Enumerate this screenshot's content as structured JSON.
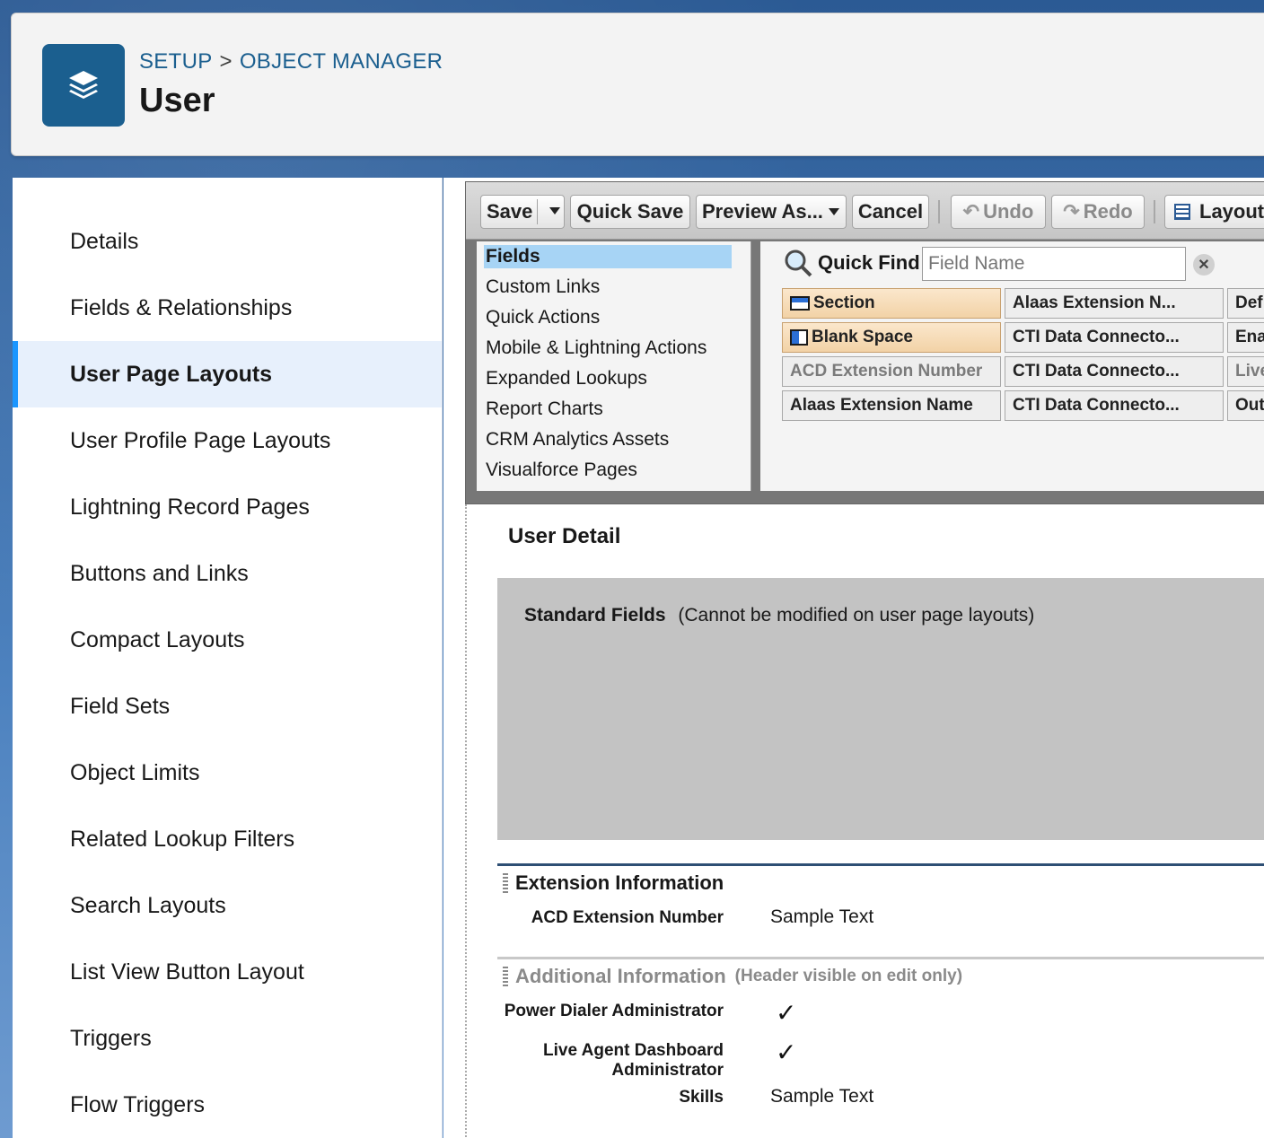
{
  "header": {
    "breadcrumb_setup": "SETUP",
    "breadcrumb_sep": ">",
    "breadcrumb_object_manager": "OBJECT MANAGER",
    "title": "User",
    "icon": "layers-icon",
    "icon_color": "#1b5f8f"
  },
  "sidebar": {
    "items": [
      {
        "label": "Details"
      },
      {
        "label": "Fields & Relationships"
      },
      {
        "label": "User Page Layouts",
        "active": true
      },
      {
        "label": "User Profile Page Layouts"
      },
      {
        "label": "Lightning Record Pages"
      },
      {
        "label": "Buttons and Links"
      },
      {
        "label": "Compact Layouts"
      },
      {
        "label": "Field Sets"
      },
      {
        "label": "Object Limits"
      },
      {
        "label": "Related Lookup Filters"
      },
      {
        "label": "Search Layouts"
      },
      {
        "label": "List View Button Layout"
      },
      {
        "label": "Triggers"
      },
      {
        "label": "Flow Triggers"
      }
    ],
    "active_accent": "#1b96ff"
  },
  "toolbar": {
    "save": "Save",
    "quick_save": "Quick Save",
    "preview_as": "Preview As...",
    "cancel": "Cancel",
    "undo": "Undo",
    "redo": "Redo",
    "layout": "Layout"
  },
  "palette": {
    "categories": [
      {
        "label": "Fields",
        "selected": true
      },
      {
        "label": "Custom Links"
      },
      {
        "label": "Quick Actions"
      },
      {
        "label": "Mobile & Lightning Actions"
      },
      {
        "label": "Expanded Lookups"
      },
      {
        "label": "Report Charts"
      },
      {
        "label": "CRM Analytics Assets"
      },
      {
        "label": "Visualforce Pages"
      }
    ],
    "quick_find_label": "Quick Find",
    "quick_find_placeholder": "Field Name",
    "fields": {
      "col1": [
        "Section",
        "Blank Space",
        "ACD Extension Number",
        "Alaas Extension Name"
      ],
      "col2": [
        "Alaas Extension N...",
        "CTI Data Connecto...",
        "CTI Data Connecto...",
        "CTI Data Connecto..."
      ],
      "col3": [
        "Def",
        "Ena",
        "Live",
        "Out"
      ]
    }
  },
  "canvas": {
    "detail_title": "User Detail",
    "standard_fields_label": "Standard Fields",
    "standard_fields_note": "(Cannot be modified on user page layouts)",
    "sections": [
      {
        "name": "Extension Information",
        "fields": [
          {
            "label": "ACD Extension Number",
            "value": "Sample Text"
          }
        ]
      },
      {
        "name": "Additional Information",
        "note": "(Header visible on edit only)",
        "fields": [
          {
            "label": "Power Dialer Administrator",
            "checked": true
          },
          {
            "label": "Live Agent Dashboard Administrator",
            "label_line1": "Live Agent Dashboard",
            "label_line2": "Administrator",
            "checked": true
          },
          {
            "label": "Skills",
            "value": "Sample Text"
          }
        ]
      }
    ]
  }
}
